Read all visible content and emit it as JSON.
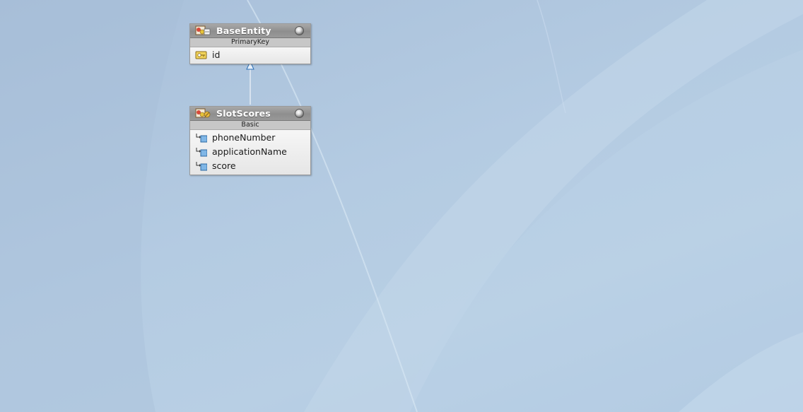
{
  "diagram": {
    "entities": [
      {
        "name": "BaseEntity",
        "stereotype": "PrimaryKey",
        "icon": "mapped-superclass-icon",
        "attributes": [
          {
            "name": "id",
            "icon": "primary-key-icon"
          }
        ]
      },
      {
        "name": "SlotScores",
        "stereotype": "Basic",
        "icon": "entity-icon",
        "attributes": [
          {
            "name": "phoneNumber",
            "icon": "basic-attribute-icon"
          },
          {
            "name": "applicationName",
            "icon": "basic-attribute-icon"
          },
          {
            "name": "score",
            "icon": "basic-attribute-icon"
          }
        ]
      }
    ],
    "relations": [
      {
        "type": "inheritance",
        "from": "SlotScores",
        "to": "BaseEntity"
      }
    ],
    "colors": {
      "header": "#999999",
      "stereotype_band": "#c7c7c7",
      "body": "#ececec",
      "canvas": "#b4cbe2",
      "connector": "#ffffff",
      "arrowhead": "#2c6fb5"
    }
  }
}
